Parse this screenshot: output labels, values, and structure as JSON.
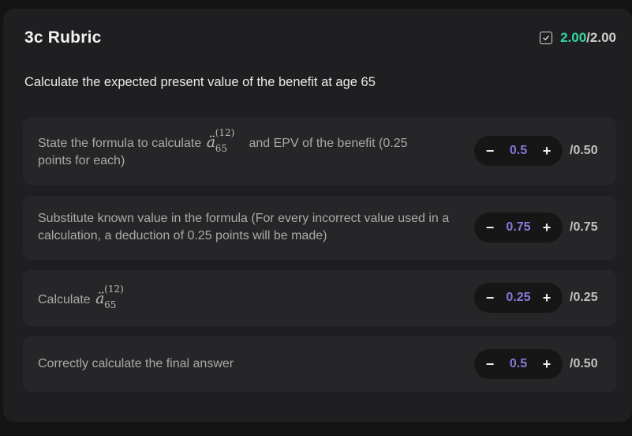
{
  "rubric": {
    "title": "3c Rubric",
    "score_got": "2.00",
    "score_slash": "/",
    "score_max": "2.00",
    "question": "Calculate the expected present value of the benefit at age 65",
    "colors": {
      "accent_green": "#35d6a3",
      "value_purple": "#8a78d8"
    }
  },
  "items": [
    {
      "text_before": "State the formula to calculate",
      "math_base": "ä",
      "math_sup": "(12)",
      "math_sub": "65",
      "text_after": "and EPV of the benefit (0.25",
      "text_line2": "points for each)",
      "minus": "−",
      "value": "0.5",
      "plus": "+",
      "max": "/0.50"
    },
    {
      "text": "Substitute known value in the formula (For every incorrect value used in a calculation, a deduction of 0.25 points will be made)",
      "minus": "−",
      "value": "0.75",
      "plus": "+",
      "max": "/0.75"
    },
    {
      "text_before": "Calculate",
      "math_base": "ä",
      "math_sup": "(12)",
      "math_sub": "65",
      "minus": "−",
      "value": "0.25",
      "plus": "+",
      "max": "/0.25"
    },
    {
      "text": "Correctly calculate the final answer",
      "minus": "−",
      "value": "0.5",
      "plus": "+",
      "max": "/0.50"
    }
  ]
}
